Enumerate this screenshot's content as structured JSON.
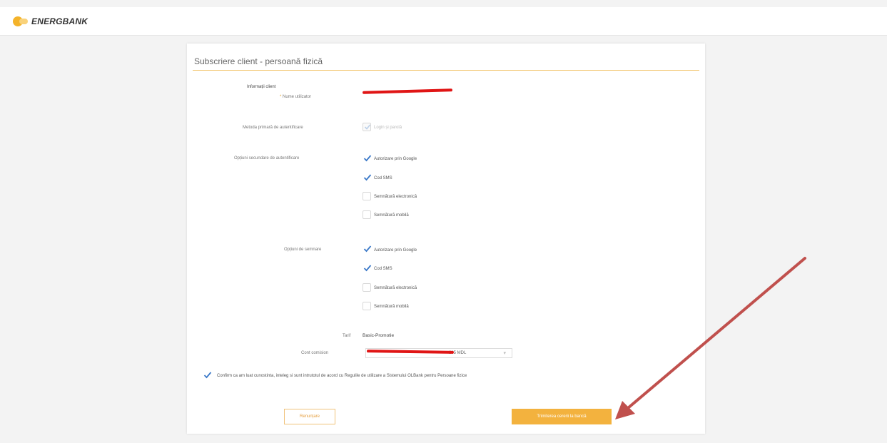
{
  "header": {
    "brand": "ENERGBANK",
    "logo_icon": "energbank-logo-icon"
  },
  "form": {
    "title": "Subscriere client - persoană fizică",
    "section": "Informații client",
    "username": {
      "label": "Nume utilizator",
      "required_mark": "*"
    },
    "primary_auth": {
      "label": "Metoda primară de autentificare",
      "option": "Login și parolă",
      "checked": true,
      "disabled": true
    },
    "secondary_auth": {
      "label": "Opțiuni secundare de autentificare",
      "options": [
        {
          "label": "Autorizare prin Google",
          "checked": true
        },
        {
          "label": "Cod SMS",
          "checked": true
        },
        {
          "label": "Semnătură electronică",
          "checked": false
        },
        {
          "label": "Semnătură mobilă",
          "checked": false
        }
      ]
    },
    "signing": {
      "label": "Opțiuni de semnare",
      "options": [
        {
          "label": "Autorizare prin Google",
          "checked": true
        },
        {
          "label": "Cod SMS",
          "checked": true
        },
        {
          "label": "Semnătură electronică",
          "checked": false
        },
        {
          "label": "Semnătură mobilă",
          "checked": false
        }
      ]
    },
    "tariff": {
      "label": "Tarif",
      "value": "Basic-Promotie"
    },
    "commission_account": {
      "label": "Cont comision",
      "value": "845 MDL"
    },
    "confirm": {
      "text": "Confirm ca am luat cunostinta, inteleg si sunt intrutotul de acord cu Regulile de utilizare a Sistemului OLBank pentru Persoane fizice",
      "checked": true
    },
    "buttons": {
      "cancel": "Renunțare",
      "submit": "Trimiterea cererii la bancă"
    }
  },
  "colors": {
    "accent": "#f3b23e",
    "check": "#3a78c8",
    "redaction": "#e01515",
    "annotation_arrow": "#c0504d"
  }
}
